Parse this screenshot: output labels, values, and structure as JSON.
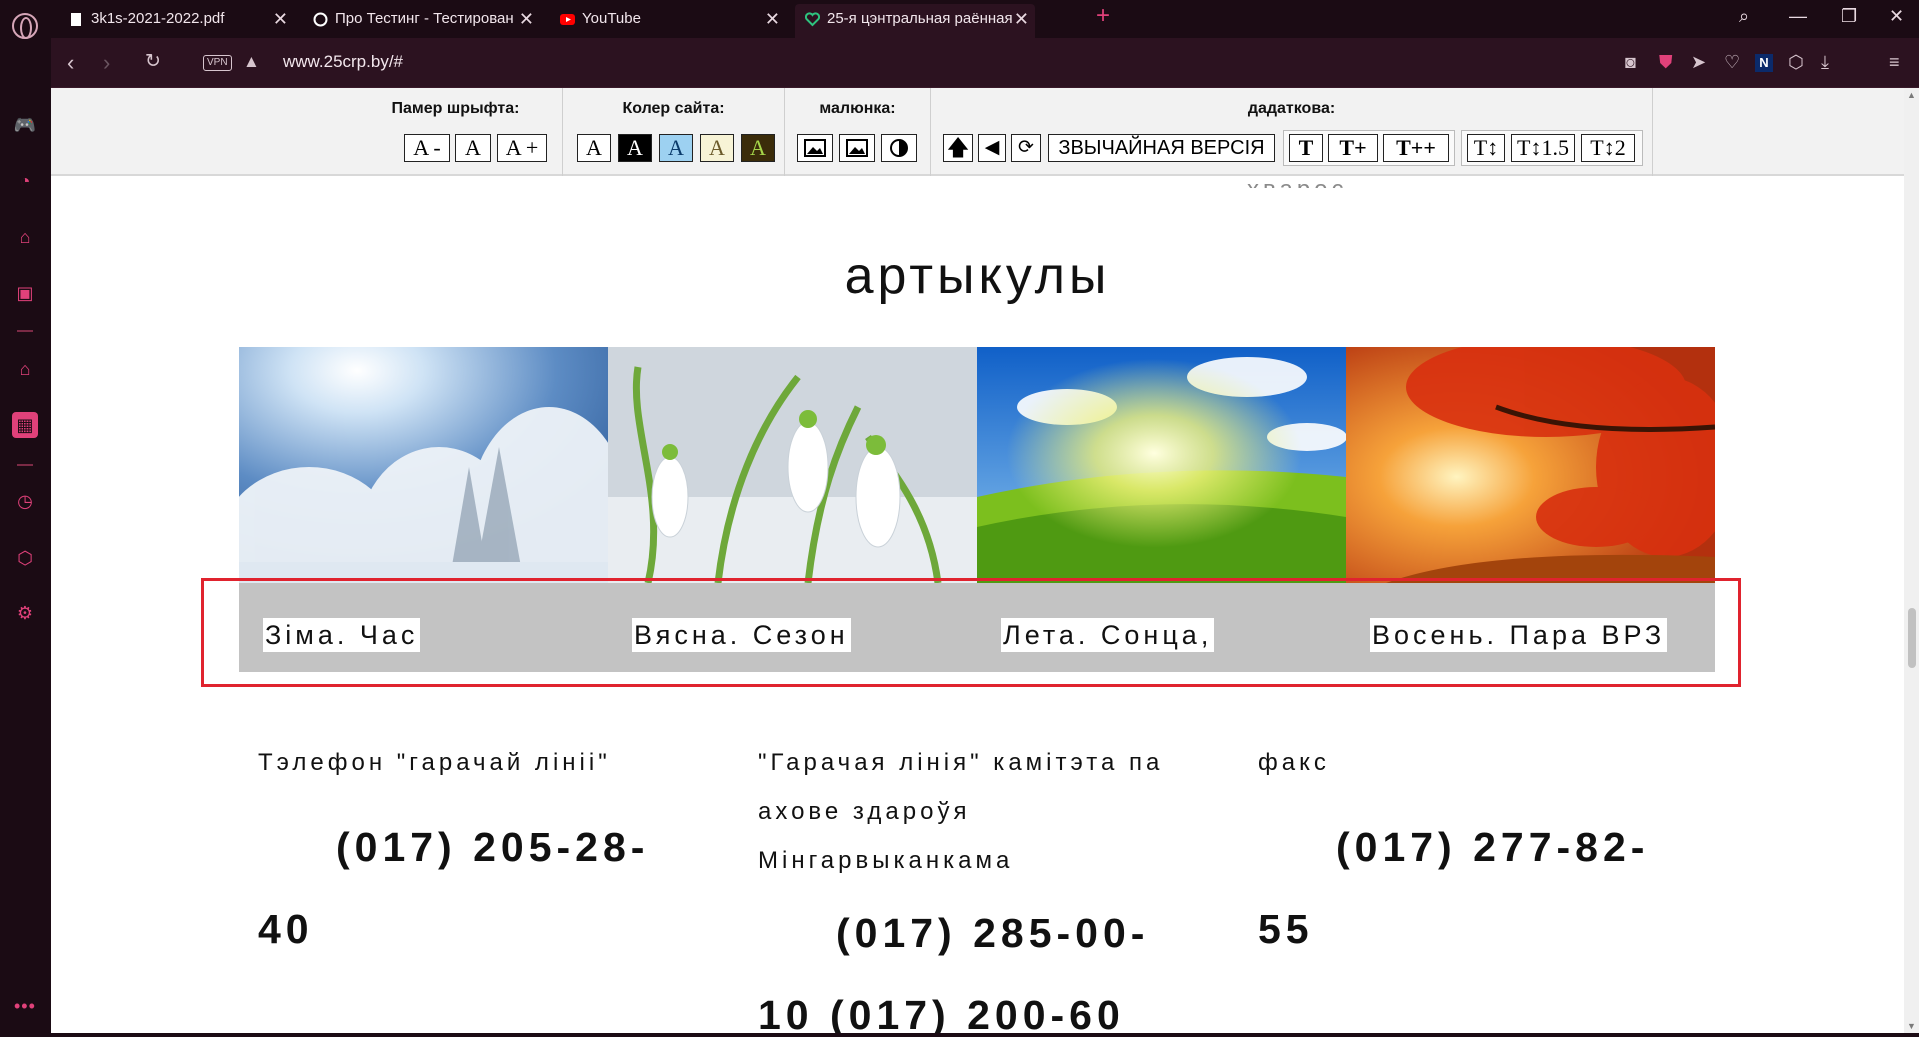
{
  "browser": {
    "tabs": [
      {
        "title": "3k1s-2021-2022.pdf",
        "icon": "document-icon",
        "active": false
      },
      {
        "title": "Про Тестинг - Тестирован",
        "icon": "gear-logo-icon",
        "active": false
      },
      {
        "title": "YouTube",
        "icon": "youtube-icon",
        "active": false
      },
      {
        "title": "25-я цэнтральная раённая",
        "icon": "heart-logo-icon",
        "active": true
      }
    ],
    "vpn_label": "VPN",
    "url": "www.25crp.by/#"
  },
  "accessibility_panel": {
    "font_size_title": "Памер шрыфта:",
    "font_size_buttons": [
      "A -",
      "A",
      "A +"
    ],
    "site_color_title": "Колер сайта:",
    "site_color_buttons": [
      "A",
      "A",
      "A",
      "A",
      "A"
    ],
    "site_color_colors": [
      "#ffffff",
      "#000000",
      "#9dd1f1",
      "#f7f3d6",
      "#3b2c0a"
    ],
    "images_title": "малюнка:",
    "extra_title": "дадаткова:",
    "normal_version_label": "ЗВЫЧАЙНАЯ ВЕРСІЯ",
    "letter_spacing_buttons": [
      "T",
      "T+",
      "T++"
    ],
    "line_height_buttons": [
      "T↕",
      "T↕1.5",
      "T↕2"
    ]
  },
  "page": {
    "cut_text_top": "хварос",
    "heading": "артыкулы",
    "articles": [
      {
        "title_line1": "Зіма. Час",
        "title_line2": "",
        "image": "winter-forest"
      },
      {
        "title_line1": "Вясна. Сезон",
        "title_line2": "",
        "image": "snowdrops"
      },
      {
        "title_line1": "Лета. Сонца,",
        "title_line2": "",
        "image": "summer-field"
      },
      {
        "title_line1": "Восень. Пара ВРЗ",
        "title_line2": "",
        "image": "autumn-leaves"
      }
    ],
    "contacts": [
      {
        "label": "Тэлефон \"гарачай лініі\"",
        "phone_line1": "(017) 205-28-",
        "phone_line2": "40"
      },
      {
        "label": "\"Гарачая лінія\" камітэта па ахове здароўя Мінгарвыканкама",
        "phone_line1": "(017) 285-00-",
        "phone_line2": "10 (017) 200-60"
      },
      {
        "label": "факс",
        "phone_line1": "(017) 277-82-",
        "phone_line2": "55"
      }
    ]
  }
}
